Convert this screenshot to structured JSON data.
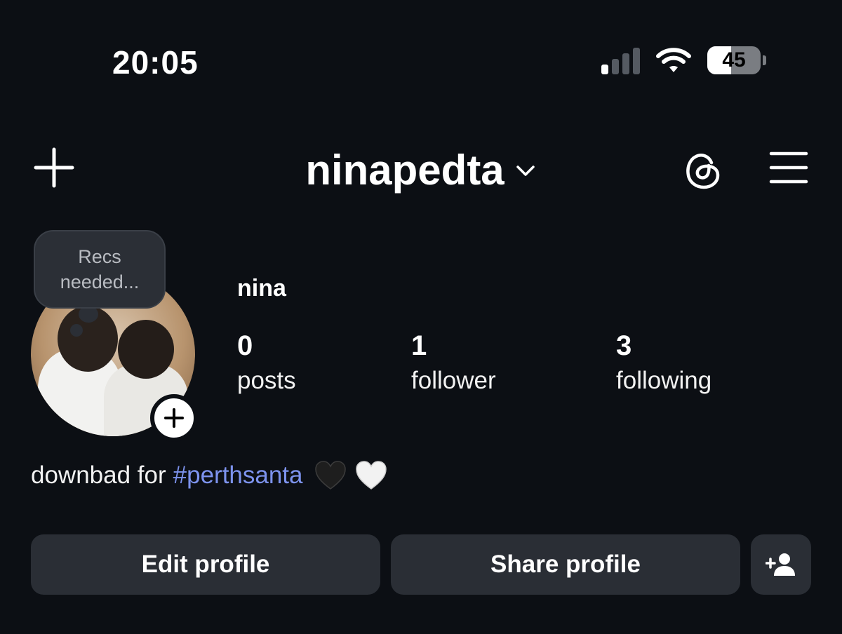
{
  "status_bar": {
    "time": "20:05",
    "battery_level": "45",
    "battery_fraction": 0.45,
    "signal_bars_active": 1,
    "signal_bars_total": 4,
    "icons": [
      "cellular-signal-icon",
      "wifi-icon",
      "battery-icon"
    ]
  },
  "header": {
    "username": "ninapedta",
    "icons": [
      "plus-icon",
      "chevron-down-icon",
      "threads-icon",
      "menu-icon"
    ]
  },
  "profile": {
    "note_bubble": "Recs needed...",
    "display_name": "nina",
    "stats": [
      {
        "value": "0",
        "label": "posts"
      },
      {
        "value": "1",
        "label": "follower"
      },
      {
        "value": "3",
        "label": "following"
      }
    ],
    "bio_text": "downbad for",
    "bio_hashtag": "#perthsanta",
    "bio_emojis": [
      "black-heart",
      "white-heart"
    ]
  },
  "actions": {
    "edit_profile": "Edit profile",
    "share_profile": "Share profile",
    "discover_people_icon": "add-person-icon"
  },
  "colors": {
    "background": "#0c0f14",
    "button_bg": "#2a2e35",
    "hashtag": "#7d93ee",
    "text": "#f5f5f5"
  }
}
